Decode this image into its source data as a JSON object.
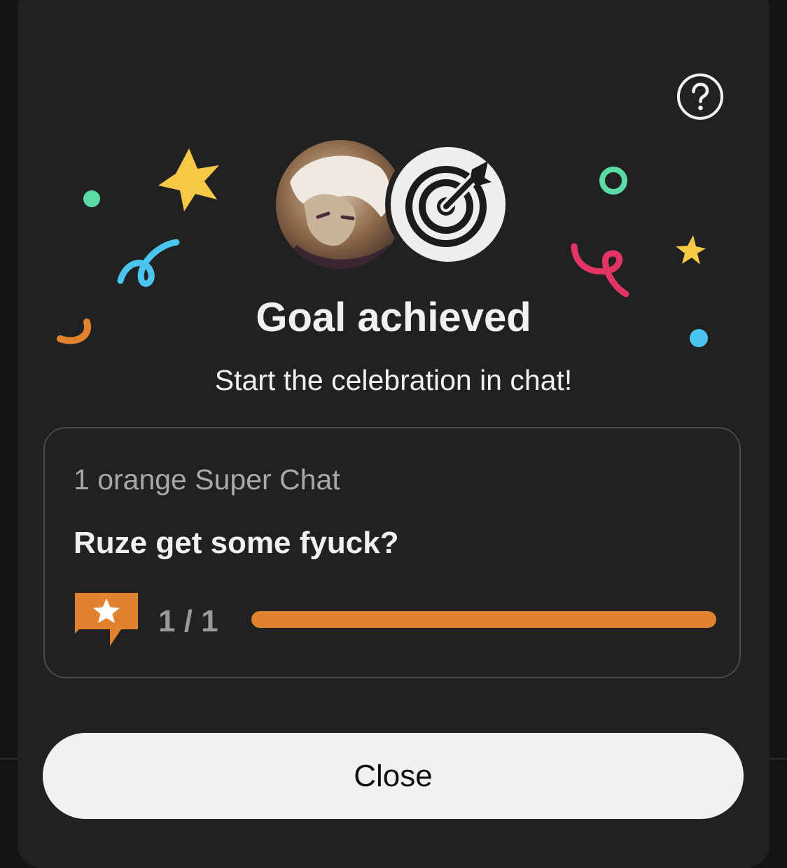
{
  "dialog": {
    "title": "Goal achieved",
    "subtitle": "Start the celebration in chat!"
  },
  "icons": {
    "help": "help-circle-icon",
    "goal_badge": "target-arrow-icon",
    "superchat": "super-chat-star-icon"
  },
  "goal_card": {
    "type_label": "1 orange Super Chat",
    "goal_text": "Ruze get some fyuck?",
    "progress_label": "1 / 1",
    "progress_fraction": 1.0
  },
  "buttons": {
    "close_label": "Close"
  },
  "colors": {
    "sheet_background": "#212121",
    "accent_orange": "#e1832e",
    "confetti_green": "#5bdba5",
    "confetti_yellow": "#f7c845",
    "confetti_blue": "#4cc4f0",
    "confetti_pink": "#e33565"
  }
}
